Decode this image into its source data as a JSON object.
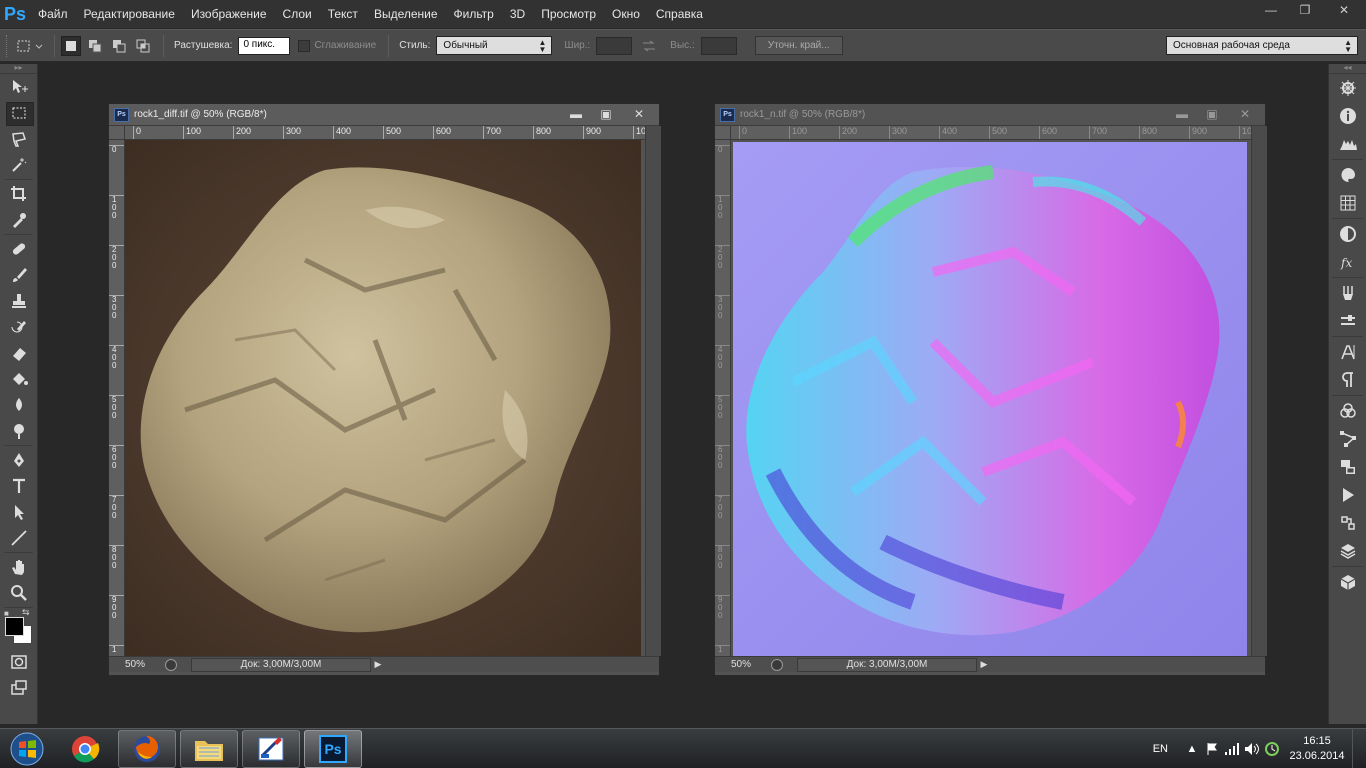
{
  "app": {
    "logo": "Ps",
    "menu": [
      "Файл",
      "Редактирование",
      "Изображение",
      "Слои",
      "Текст",
      "Выделение",
      "Фильтр",
      "3D",
      "Просмотр",
      "Окно",
      "Справка"
    ],
    "window_controls": {
      "minimize": "—",
      "restore": "❐",
      "close": "✕"
    }
  },
  "options": {
    "feather_label": "Растушевка:",
    "feather_value": "0 пикс.",
    "antialias_label": "Сглаживание",
    "style_label": "Стиль:",
    "style_value": "Обычный",
    "width_label": "Шир.:",
    "width_value": "",
    "height_label": "Выс.:",
    "height_value": "",
    "refine_edge": "Уточн. край...",
    "workspace": "Основная рабочая среда"
  },
  "documents": [
    {
      "title": "rock1_diff.tif @ 50% (RGB/8*)",
      "active": true,
      "ruler_h": [
        "0",
        "100",
        "200",
        "300",
        "400",
        "500",
        "600",
        "700",
        "800",
        "900",
        "10"
      ],
      "ruler_v": [
        "0",
        "1\n0\n0",
        "2\n0\n0",
        "3\n0\n0",
        "4\n0\n0",
        "5\n0\n0",
        "6\n0\n0",
        "7\n0\n0",
        "8\n0\n0",
        "9\n0\n0",
        "1"
      ],
      "zoom": "50%",
      "doc_size": "Док: 3,00M/3,00M"
    },
    {
      "title": "rock1_n.tif @ 50% (RGB/8*)",
      "active": false,
      "ruler_h": [
        "0",
        "100",
        "200",
        "300",
        "400",
        "500",
        "600",
        "700",
        "800",
        "900",
        "10"
      ],
      "ruler_v": [
        "0",
        "1\n0\n0",
        "2\n0\n0",
        "3\n0\n0",
        "4\n0\n0",
        "5\n0\n0",
        "6\n0\n0",
        "7\n0\n0",
        "8\n0\n0",
        "9\n0\n0",
        "1"
      ],
      "zoom": "50%",
      "doc_size": "Док: 3,00M/3,00M"
    }
  ],
  "doc_controls": {
    "minimize": "▬",
    "maximize": "▣",
    "close": "✕"
  },
  "tools": [
    "move-tool",
    "marquee-tool",
    "lasso-tool",
    "magic-wand-tool",
    "crop-tool",
    "eyedropper-tool",
    "healing-brush-tool",
    "brush-tool",
    "clone-stamp-tool",
    "history-brush-tool",
    "eraser-tool",
    "paint-bucket-tool",
    "blur-tool",
    "dodge-tool",
    "pen-tool",
    "type-tool",
    "path-selection-tool",
    "line-tool",
    "hand-tool",
    "zoom-tool"
  ],
  "colors": {
    "foreground": "#000000",
    "background": "#ffffff",
    "accent": "#31a8ff"
  },
  "taskbar": {
    "apps": [
      "chrome",
      "firefox",
      "explorer",
      "paint",
      "photoshop"
    ],
    "language": "EN",
    "time": "16:15",
    "date": "23.06.2014",
    "photoshop_label": "Ps"
  }
}
